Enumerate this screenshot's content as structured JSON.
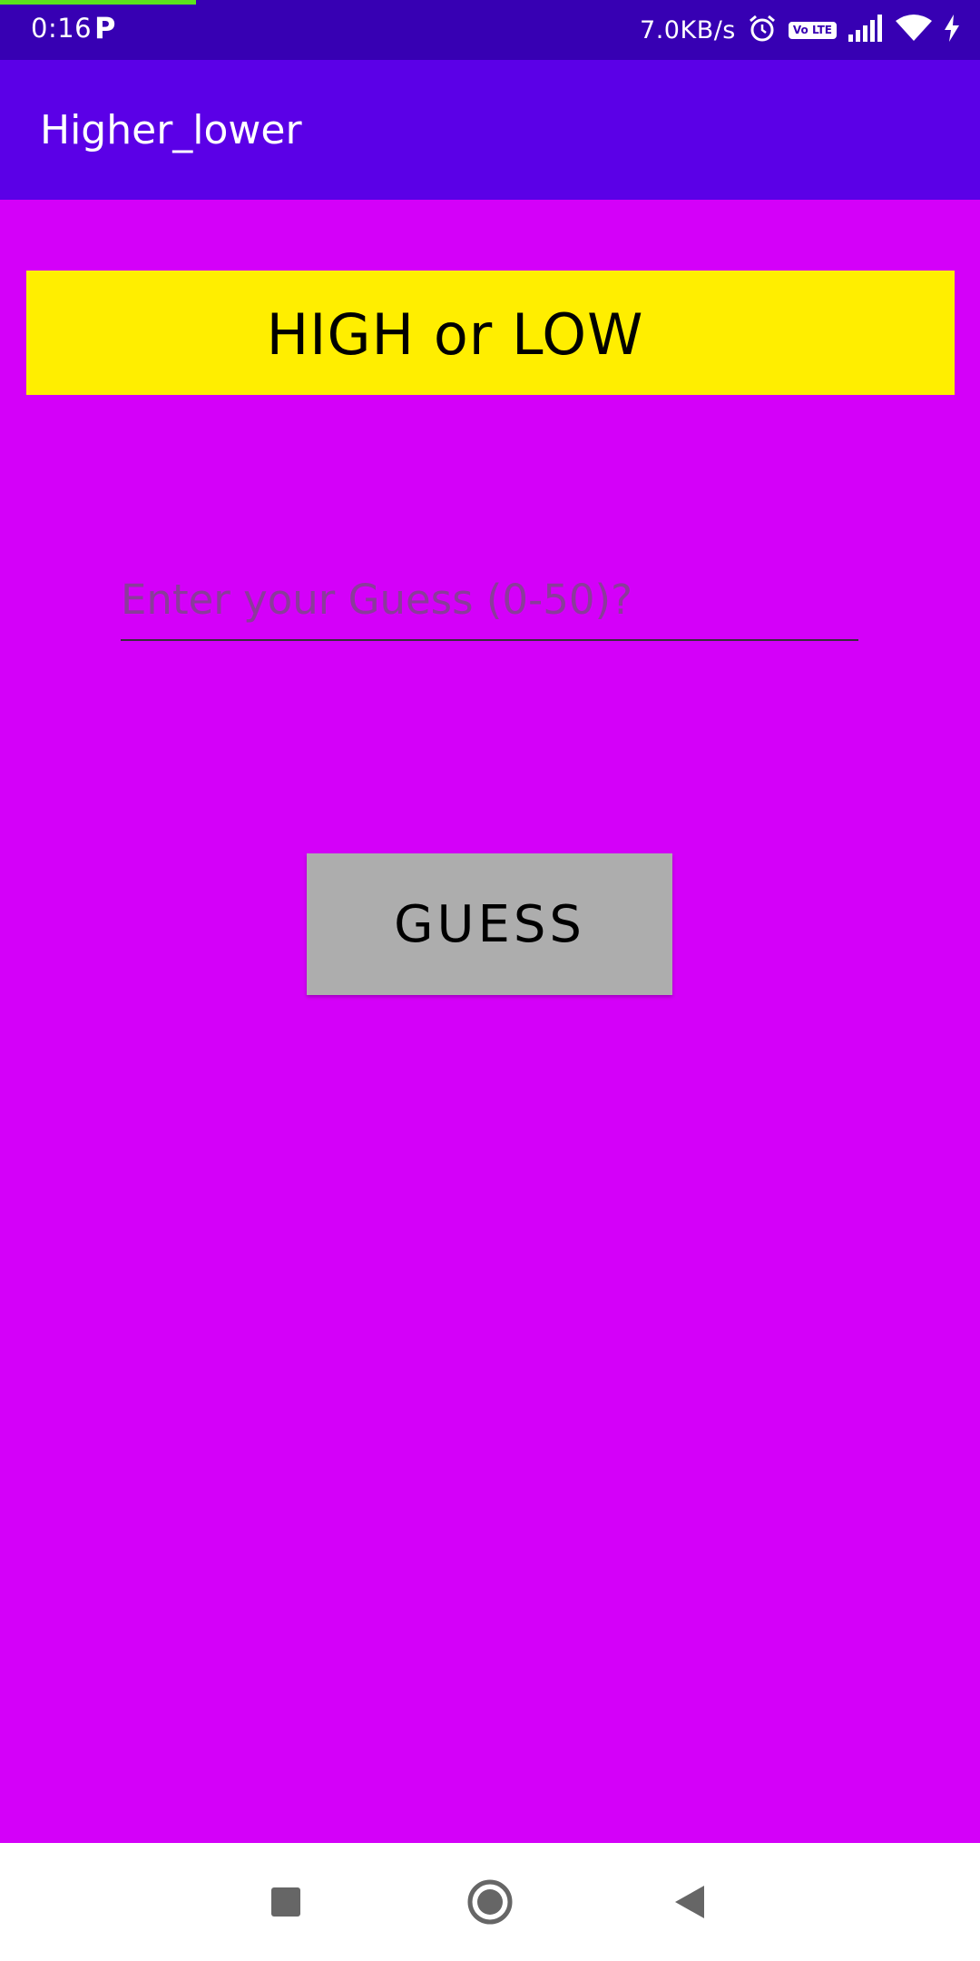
{
  "status_bar": {
    "time": "0:16",
    "notification_glyph": "P",
    "network_speed": "7.0KB/s",
    "volte_label": "Vo LTE",
    "icons": [
      "alarm-icon",
      "volte-icon",
      "signal-icon",
      "wifi-icon",
      "charging-icon"
    ]
  },
  "app_bar": {
    "title": "Higher_lower"
  },
  "banner": {
    "text": "HIGH or LOW"
  },
  "guess_input": {
    "placeholder": "Enter your Guess (0-50)?",
    "value": ""
  },
  "guess_button": {
    "label": "GUESS"
  },
  "nav_bar": {
    "icons": [
      "recents-icon",
      "home-icon",
      "back-icon"
    ]
  },
  "colors": {
    "status_bar": "#3700B3",
    "app_bar": "#5B00E7",
    "background": "#D400F9",
    "banner": "#FFEE00",
    "button": "#ADADAD"
  }
}
